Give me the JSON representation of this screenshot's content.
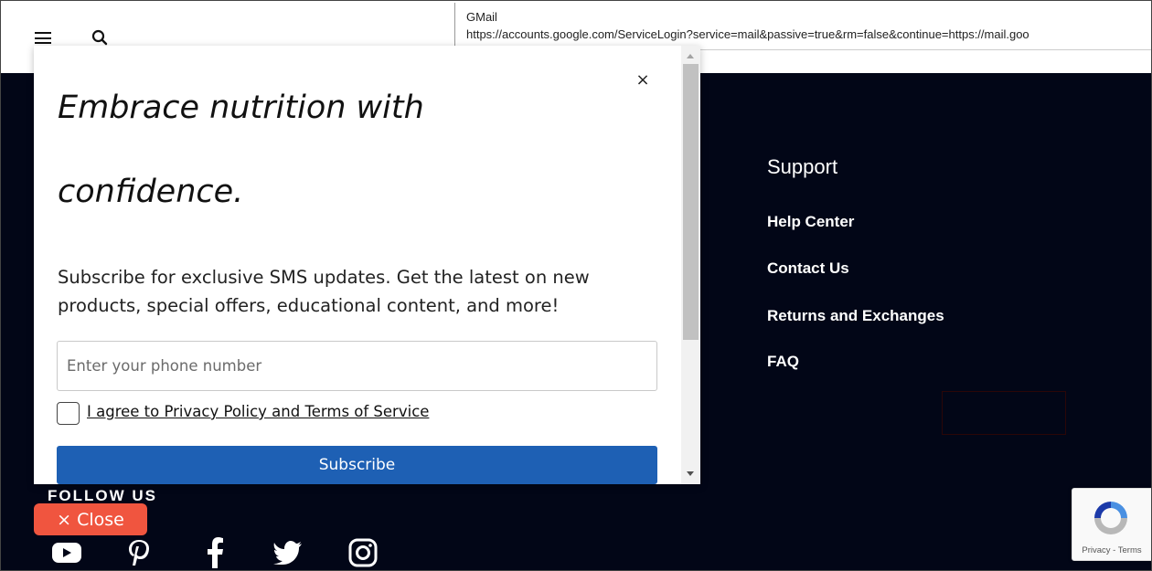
{
  "header": {
    "menu_icon": "hamburger-icon",
    "search_icon": "search-icon"
  },
  "tooltip": {
    "title": "GMail",
    "url": "https://accounts.google.com/ServiceLogin?service=mail&passive=true&rm=false&continue=https://mail.goo"
  },
  "modal": {
    "headline_line1": "Embrace nutrition with",
    "headline_line2": "confidence.",
    "description": "Subscribe for exclusive SMS updates. Get the latest on new products, special offers, educational content, and more!",
    "phone_placeholder": "Enter your phone number",
    "phone_value": "",
    "agree_label": "I agree to Privacy Policy and Terms of Service",
    "subscribe_label": "Subscribe",
    "close_glyph": "×"
  },
  "support": {
    "title": "Support",
    "links": [
      "Help Center",
      "Contact Us",
      "Returns and Exchanges",
      "FAQ"
    ]
  },
  "follow": {
    "title": "FOLLOW US",
    "icons": [
      "youtube-icon",
      "pinterest-icon",
      "facebook-icon",
      "twitter-icon",
      "instagram-icon"
    ]
  },
  "close_pill": {
    "label": "× Close"
  },
  "recaptcha": {
    "text": "Privacy - Terms"
  },
  "colors": {
    "page_bg": "#020617",
    "subscribe_bg": "#1e60b4",
    "close_pill_bg": "#f0553f",
    "recaptcha_blue": "#4a90e2"
  }
}
